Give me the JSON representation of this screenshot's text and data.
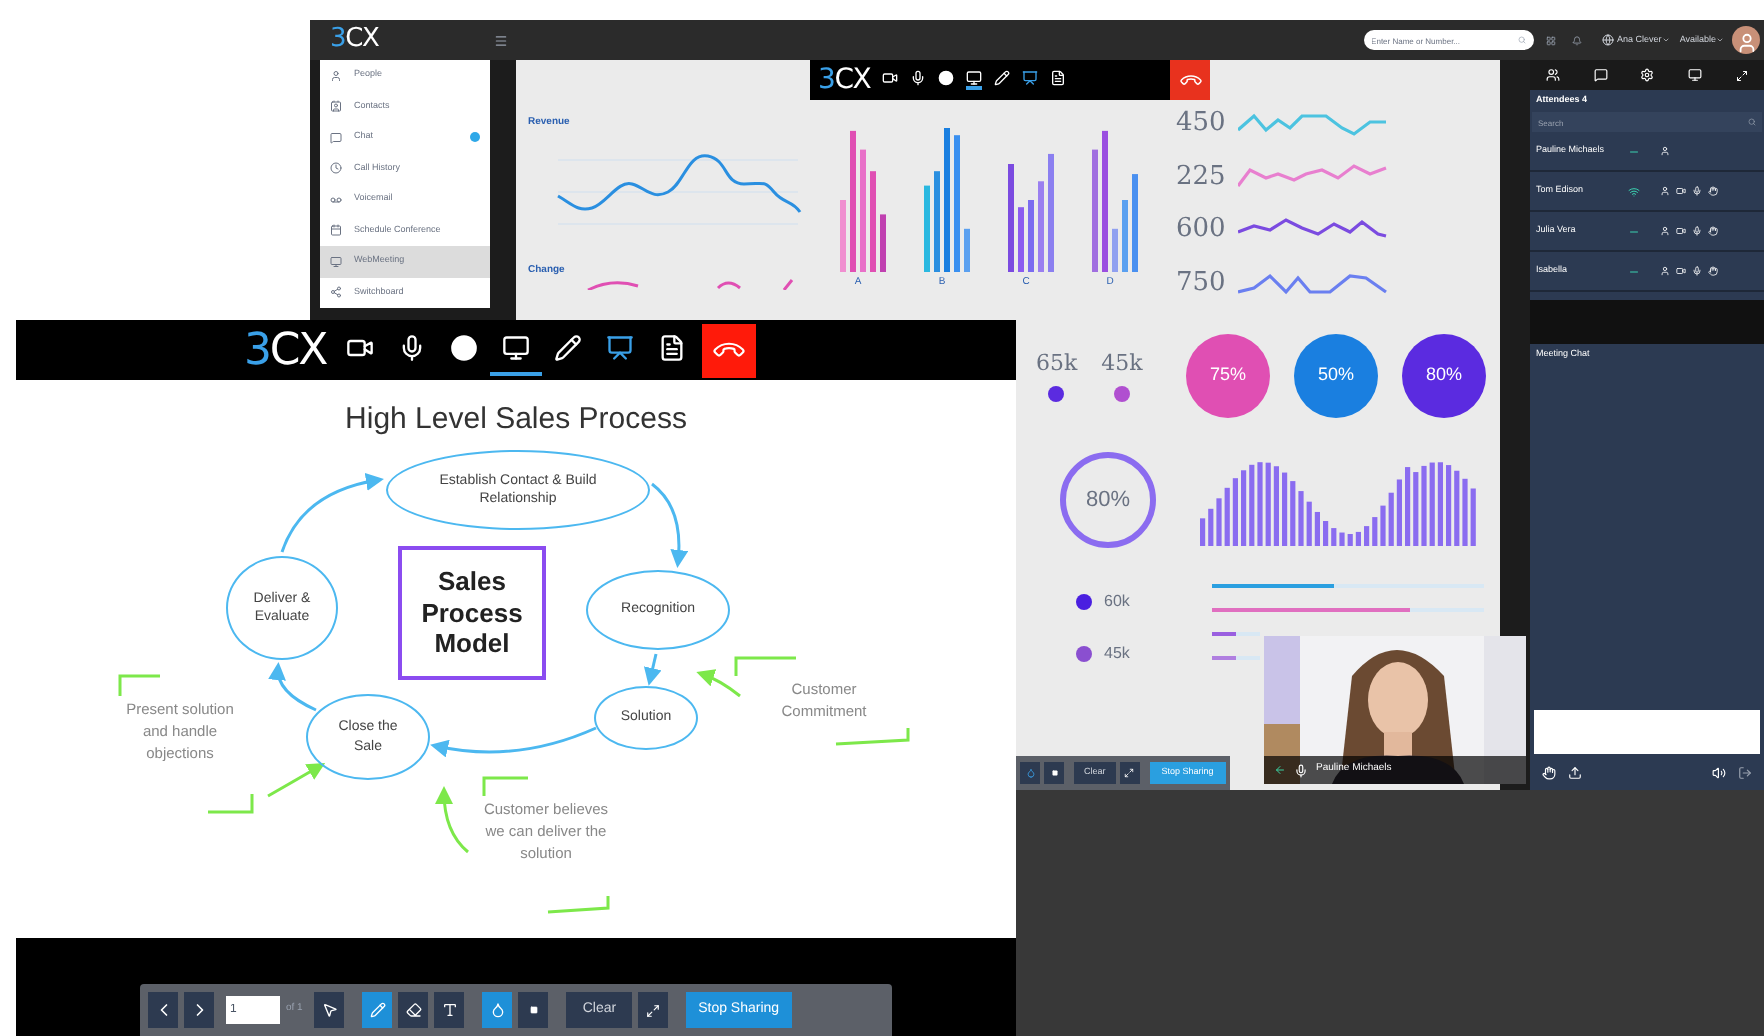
{
  "app": {
    "logo": "3CX",
    "search": {
      "placeholder": "Enter Name or Number..."
    },
    "user": "Ana Clever",
    "status": "Available"
  },
  "sidebar": {
    "items": [
      {
        "label": "People",
        "selected": false,
        "unread": false
      },
      {
        "label": "Contacts",
        "selected": false,
        "unread": false
      },
      {
        "label": "Chat",
        "selected": false,
        "unread": true
      },
      {
        "label": "Call History",
        "selected": false,
        "unread": false
      },
      {
        "label": "Voicemail",
        "selected": false,
        "unread": false
      },
      {
        "label": "Schedule Conference",
        "selected": false,
        "unread": false
      },
      {
        "label": "WebMeeting",
        "selected": true,
        "unread": false
      },
      {
        "label": "Switchboard",
        "selected": false,
        "unread": false
      }
    ]
  },
  "dashboard": {
    "revenue_title": "Revenue",
    "change_title": "Change",
    "bar_groups": [
      "A",
      "B",
      "C",
      "D"
    ],
    "sparklines": [
      {
        "value": "450",
        "color": "#4cc3e0"
      },
      {
        "value": "225",
        "color": "#e87fcf"
      },
      {
        "value": "600",
        "color": "#7b4be0"
      },
      {
        "value": "750",
        "color": "#6a7ff0"
      }
    ],
    "stats": [
      {
        "value": "65k",
        "color": "#5b2be0"
      },
      {
        "value": "45k",
        "color": "#b04fd0"
      }
    ],
    "gauges": [
      {
        "label": "75%",
        "color": "#e04fb3"
      },
      {
        "label": "50%",
        "color": "#1a7fe0"
      },
      {
        "label": "80%",
        "color": "#5b2be0"
      }
    ],
    "ring": {
      "label": "80%"
    },
    "dot_stats": [
      {
        "value": "60k",
        "color": "#4a1fe0"
      },
      {
        "value": "45k",
        "color": "#8a4fd0"
      }
    ],
    "sliders": [
      {
        "level": 0.45,
        "color": "#2a9fe0"
      },
      {
        "level": 0.73,
        "color": "#e06fc0"
      },
      {
        "level": 0.5,
        "color": "#9a5fe0"
      },
      {
        "level": 0.5,
        "color": "#b07fe0"
      }
    ],
    "toolbar": {
      "clear": "Clear",
      "stop": "Stop Sharing"
    }
  },
  "meeting_toolbar": {
    "logo": "3CX"
  },
  "attendees": {
    "title": "Attendees 4",
    "search": {
      "placeholder": "Search"
    },
    "rows": [
      {
        "name": "Pauline Michaels",
        "connected": false
      },
      {
        "name": "Tom Edison",
        "connected": true
      },
      {
        "name": "Julia Vera",
        "connected": false
      },
      {
        "name": "Isabella",
        "connected": false
      }
    ]
  },
  "chat": {
    "title": "Meeting Chat"
  },
  "video": {
    "name": "Pauline Michaels"
  },
  "share_window": {
    "logo": "3CX",
    "controls": [
      {
        "kind": "camera",
        "selected": false
      },
      {
        "kind": "mic",
        "selected": false
      },
      {
        "kind": "record",
        "selected": false
      },
      {
        "kind": "screen",
        "selected": true
      },
      {
        "kind": "pen",
        "selected": false
      },
      {
        "kind": "whiteboard",
        "selected": false
      },
      {
        "kind": "document",
        "selected": false
      }
    ],
    "slide": {
      "title": "High Level Sales Process",
      "nodes": [
        {
          "kind": "ellipse",
          "label": "Establish Contact & Build Relationship"
        },
        {
          "kind": "ellipse",
          "label": "Deliver & Evaluate"
        },
        {
          "kind": "box",
          "label": "Sales Process Model"
        },
        {
          "kind": "ellipse",
          "label": "Recognition"
        },
        {
          "kind": "ellipse",
          "label": "Close the Sale"
        },
        {
          "kind": "ellipse",
          "label": "Solution"
        }
      ],
      "notes": [
        "Present solution and handle objections",
        "Customer Commitment",
        "Customer believes we can deliver the solution"
      ]
    },
    "toolbar": {
      "page": "1",
      "of": "of 1",
      "clear": "Clear",
      "stop": "Stop Sharing",
      "tools": [
        {
          "kind": "pointer",
          "selected": false
        },
        {
          "kind": "pencil",
          "selected": true
        },
        {
          "kind": "eraser",
          "selected": false
        },
        {
          "kind": "text",
          "selected": false
        },
        {
          "kind": "color",
          "selected": true
        },
        {
          "kind": "size",
          "selected": false
        }
      ]
    }
  }
}
